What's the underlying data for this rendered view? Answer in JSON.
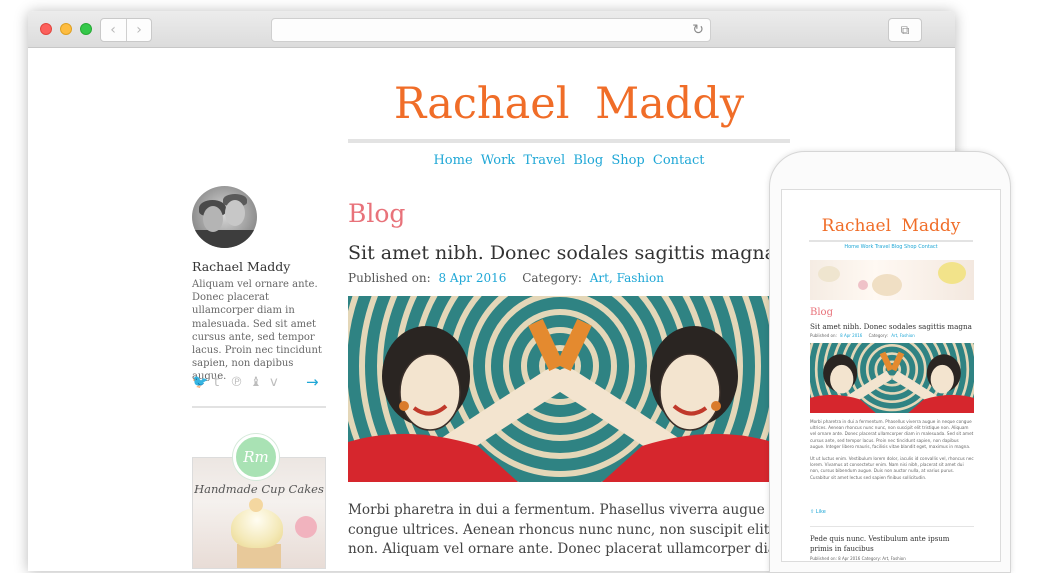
{
  "site": {
    "title": "Rachael  Maddy",
    "nav": [
      "Home",
      "Work",
      "Travel",
      "Blog",
      "Shop",
      "Contact"
    ]
  },
  "sidebar": {
    "author_name": "Rachael Maddy",
    "bio": "Aliquam vel ornare ante. Donec placerat ullamcorper diam in malesuada. Sed sit amet cursus ante, sed tempor lacus. Proin nec tincidunt sapien, non dapibus augue.",
    "social_icons": [
      "twitter-icon",
      "tumblr-icon",
      "pinterest-icon",
      "etsy-icon",
      "vimeo-icon"
    ],
    "social_glyphs": [
      "🐦",
      "t",
      "℗",
      "♝",
      "v"
    ],
    "more_arrow": "→",
    "widget": {
      "badge": "Rm",
      "title": "Handmade Cup Cakes"
    }
  },
  "main": {
    "section_heading": "Blog",
    "post": {
      "title": "Sit amet nibh. Donec sodales sagittis magna",
      "published_label": "Published on:",
      "published_date": "8 Apr 2016",
      "category_label": "Category:",
      "categories": "Art, Fashion",
      "excerpt_lines": [
        "Morbi pharetra in dui a fermentum. Phasellus viverra augue in nequ",
        "congue ultrices. Aenean rhoncus nunc nunc, non suscipit elit tristic",
        "non. Aliquam vel ornare ante. Donec placerat ullamcorper diam in"
      ]
    }
  },
  "mobile": {
    "title": "Rachael  Maddy",
    "nav": "Home Work Travel Blog Shop Contact",
    "section_heading": "Blog",
    "post_title": "Sit amet nibh. Donec sodales sagittis magna",
    "published_label": "Published on:",
    "published_date": "8 Apr 2016",
    "category_label": "Category:",
    "categories": "Art, Fashion",
    "paragraph1": "Morbi pharetra in dui a fermentum. Phasellus viverra augue in neque congue ultrices. Aenean rhoncus nunc nunc, non suscipit elit tristique non. Aliquam vel ornare ante. Donec placerat ullamcorper diam in malesuada. Sed sit amet cursus ante, sed tempor lacus. Proin nec tincidunt sapien, non dapibus augue. Integer libero mauris, facilisis vitae blandit eget, maximus in magna.",
    "paragraph2": "Ut ut luctus enim. Vestibulum lorem dolor, iaculis id convallis vel, rhoncus nec lorem. Vivamus at consectetur enim. Nam nisi nibh, placerat sit amet dui non, cursus bibendum augue. Duis non auctor nulla, at varius purus. Curabitur sit amet lectus sed sapien finibus sollicitudin.",
    "share": "Like",
    "post2_title": "Pede quis nunc. Vestibulum ante ipsum primis in faucibus",
    "post2_meta": "Published on: 8 Apr 2016   Category: Art, Fashion"
  },
  "browser": {
    "back": "‹",
    "forward": "›",
    "reload": "↻",
    "tabs": "⧉"
  },
  "colors": {
    "brand": "#f06d28",
    "link": "#1fa7d6",
    "heading": "#e8727a",
    "badge": "#a9e2b4"
  }
}
